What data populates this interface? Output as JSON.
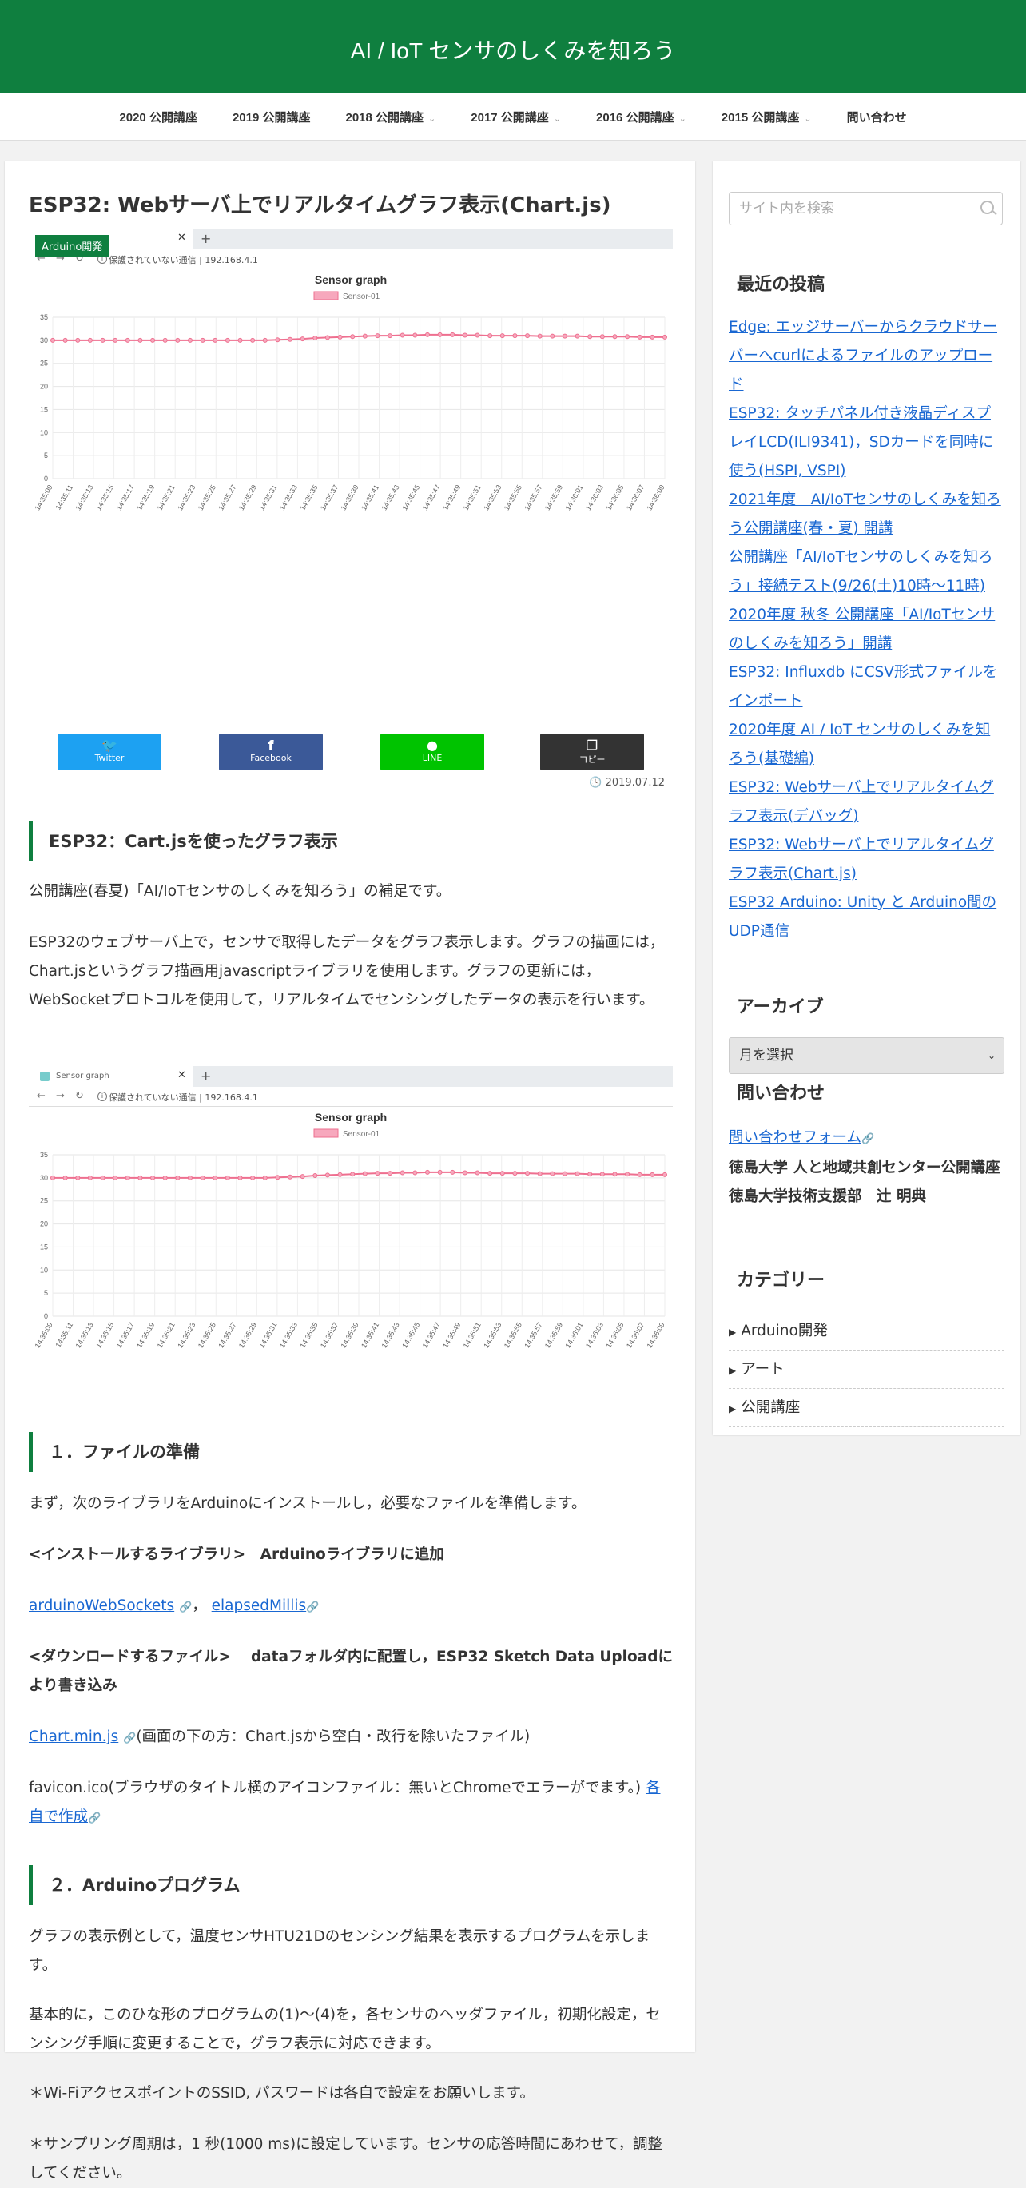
{
  "site": {
    "title": "AI / IoT センサのしくみを知ろう"
  },
  "nav": [
    {
      "label": "2020 公開講座",
      "caret": false
    },
    {
      "label": "2019 公開講座",
      "caret": false
    },
    {
      "label": "2018 公開講座",
      "caret": true
    },
    {
      "label": "2017 公開講座",
      "caret": true
    },
    {
      "label": "2016 公開講座",
      "caret": true
    },
    {
      "label": "2015 公開講座",
      "caret": true
    },
    {
      "label": "問い合わせ",
      "caret": false
    }
  ],
  "post": {
    "title": "ESP32: Webサーバ上でリアルタイムグラフ表示(Chart.js)",
    "category_badge": "Arduino開発",
    "date": "2019.07.12",
    "share": {
      "twitter": "Twitter",
      "facebook": "Facebook",
      "line": "LINE",
      "copy": "コピー"
    },
    "h_intro": "ESP32：Cart.jsを使ったグラフ表示",
    "p_intro1": "公開講座(春夏)「AI/IoTセンサのしくみを知ろう」の補足です。",
    "p_intro2": "ESP32のウェブサーバ上で，センサで取得したデータをグラフ表示します。グラフの描画には，Chart.jsというグラフ描画用javascriptライブラリを使用します。グラフの更新には，WebSocketプロトコルを使用して，リアルタイムでセンシングしたデータの表示を行います。",
    "h_files": "１．ファイルの準備",
    "p_files1": "まず，次のライブラリをArduinoにインストールし，必要なファイルを準備します。",
    "p_files2": "<インストールするライブラリ>　Arduinoライブラリに追加",
    "link_ws": "arduinoWebSockets",
    "link_sep": "，",
    "link_elapsed": "elapsedMillis",
    "p_files3": "<ダウンロードするファイル>　 dataフォルダ内に配置し，ESP32 Sketch Data Uploadにより書き込み",
    "link_chart": "Chart.min.js",
    "p_chart_note": "(画面の下の方：Chart.jsから空白・改行を除いたファイル)",
    "p_favicon": "favicon.ico(ブラウザのタイトル横のアイコンファイル：無いとChromeでエラーがでます。)",
    "link_own": "各自で作成",
    "h_program": "２．Arduinoプログラム",
    "p_prog1": "グラフの表示例として，温度センサHTU21Dのセンシング結果を表示するプログラムを示します。",
    "p_prog2": "基本的に，このひな形のプログラムの(1)～(4)を，各センサのヘッダファイル，初期化設定，センシング手順に変更することで，グラフ表示に対応できます。",
    "p_prog3": "＊Wi-FiアクセスポイントのSSID, パスワードは各自で設定をお願いします。",
    "p_prog4": "＊サンプリング周期は，1 秒(1000 ms)に設定しています。センサの応答時間にあわせて，調整してください。"
  },
  "browser": {
    "tab_title": "Sensor graph",
    "insecure": "保護されていない通信",
    "url": "192.168.4.1"
  },
  "chart_data": [
    {
      "type": "line",
      "title": "Sensor graph",
      "series": [
        {
          "name": "Sensor-01",
          "values": [
            30,
            30,
            30,
            30,
            30,
            30,
            30,
            30,
            30,
            30,
            30,
            30,
            30,
            30,
            30,
            30,
            30,
            30,
            30.1,
            30.2,
            30.3,
            30.5,
            30.6,
            30.7,
            30.8,
            30.9,
            31,
            31,
            31.1,
            31.1,
            31.2,
            31.2,
            31.2,
            31.1,
            31.1,
            31,
            31,
            31,
            31,
            30.9,
            30.9,
            30.9,
            30.9,
            30.8,
            30.8,
            30.8,
            30.8,
            30.7,
            30.7,
            30.7
          ]
        }
      ],
      "x": [
        "14:35:09",
        "14:35:11",
        "14:35:13",
        "14:35:15",
        "14:35:17",
        "14:35:19",
        "14:35:21",
        "14:35:23",
        "14:35:25",
        "14:35:27",
        "14:35:29",
        "14:35:31",
        "14:35:33",
        "14:35:35",
        "14:35:37",
        "14:35:39",
        "14:35:41",
        "14:35:43",
        "14:35:45",
        "14:35:47",
        "14:35:49",
        "14:35:51",
        "14:35:53",
        "14:35:55",
        "14:35:57",
        "14:35:59",
        "14:36:01",
        "14:36:03",
        "14:36:05",
        "14:36:07",
        "14:36:09"
      ],
      "ylim": [
        0,
        35
      ],
      "yticks": [
        0,
        5,
        10,
        15,
        20,
        25,
        30,
        35
      ],
      "grid": true,
      "legend": "top-center"
    }
  ],
  "sidebar": {
    "search_placeholder": "サイト内を検索",
    "recent_title": "最近の投稿",
    "recent": [
      "Edge: エッジサーバーからクラウドサーバーへcurlによるファイルのアップロード",
      "ESP32: タッチパネル付き液晶ディスプレイLCD(ILI9341)，SDカードを同時に使う(HSPI, VSPI)",
      "2021年度　AI/IoTセンサのしくみを知ろう公開講座(春・夏) 開講",
      "公開講座「AI/IoTセンサのしくみを知ろう」接続テスト(9/26(土)10時～11時)",
      "2020年度 秋冬 公開講座「AI/IoTセンサのしくみを知ろう」開講",
      "ESP32: Influxdb にCSV形式ファイルをインポート",
      "2020年度 AI / IoT センサのしくみを知ろう(基礎編)",
      "ESP32: Webサーバ上でリアルタイムグラフ表示(デバッグ)",
      "ESP32: Webサーバ上でリアルタイムグラフ表示(Chart.js)",
      "ESP32 Arduino: Unity と Arduino間のUDP通信"
    ],
    "archive_title": "アーカイブ",
    "archive_select": "月を選択",
    "contact_title": "問い合わせ",
    "contact_link": "問い合わせフォーム",
    "contact_org1": "徳島大学 人と地域共創センター公開講座",
    "contact_org2": "徳島大学技術支援部　辻 明典",
    "cat_title": "カテゴリー",
    "categories": [
      "Arduino開発",
      "アート",
      "公開講座"
    ]
  }
}
